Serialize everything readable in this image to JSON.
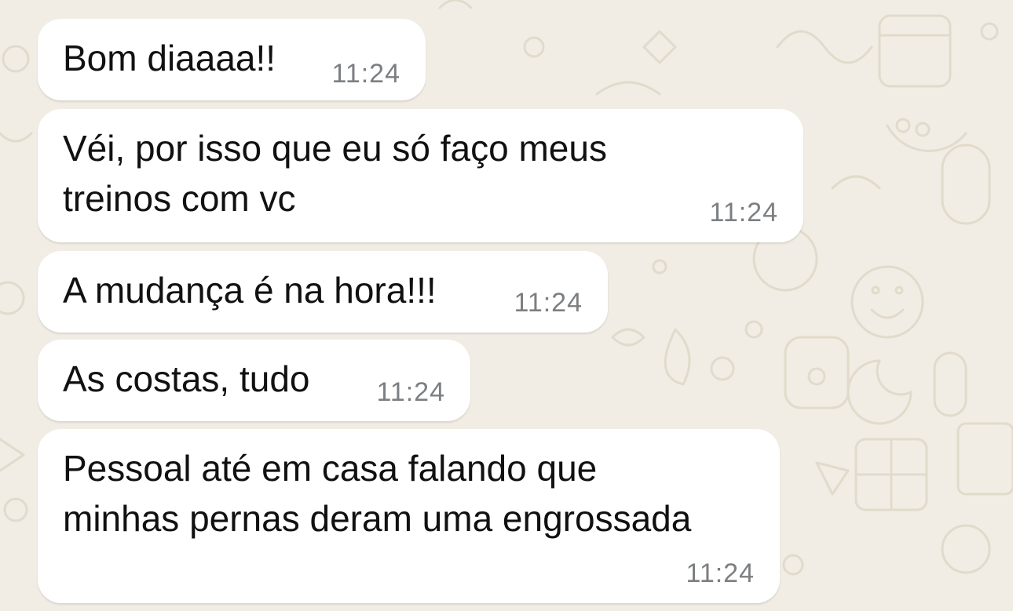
{
  "chat": {
    "messages": [
      {
        "text": "Bom diaaaa!!",
        "time": "11:24"
      },
      {
        "text": "Véi, por isso que eu só faço meus\ntreinos com vc",
        "time": "11:24"
      },
      {
        "text": "A mudança é na hora!!!",
        "time": "11:24"
      },
      {
        "text": "As costas, tudo",
        "time": "11:24"
      },
      {
        "text": "Pessoal até em casa falando que\nminhas pernas deram uma engrossada",
        "time": "11:24"
      }
    ]
  },
  "colors": {
    "wallpaper": "#f1ede4",
    "doodle": "#e2dacb",
    "bubble": "#ffffff",
    "text": "#111111",
    "timestamp": "#7c7f82"
  }
}
